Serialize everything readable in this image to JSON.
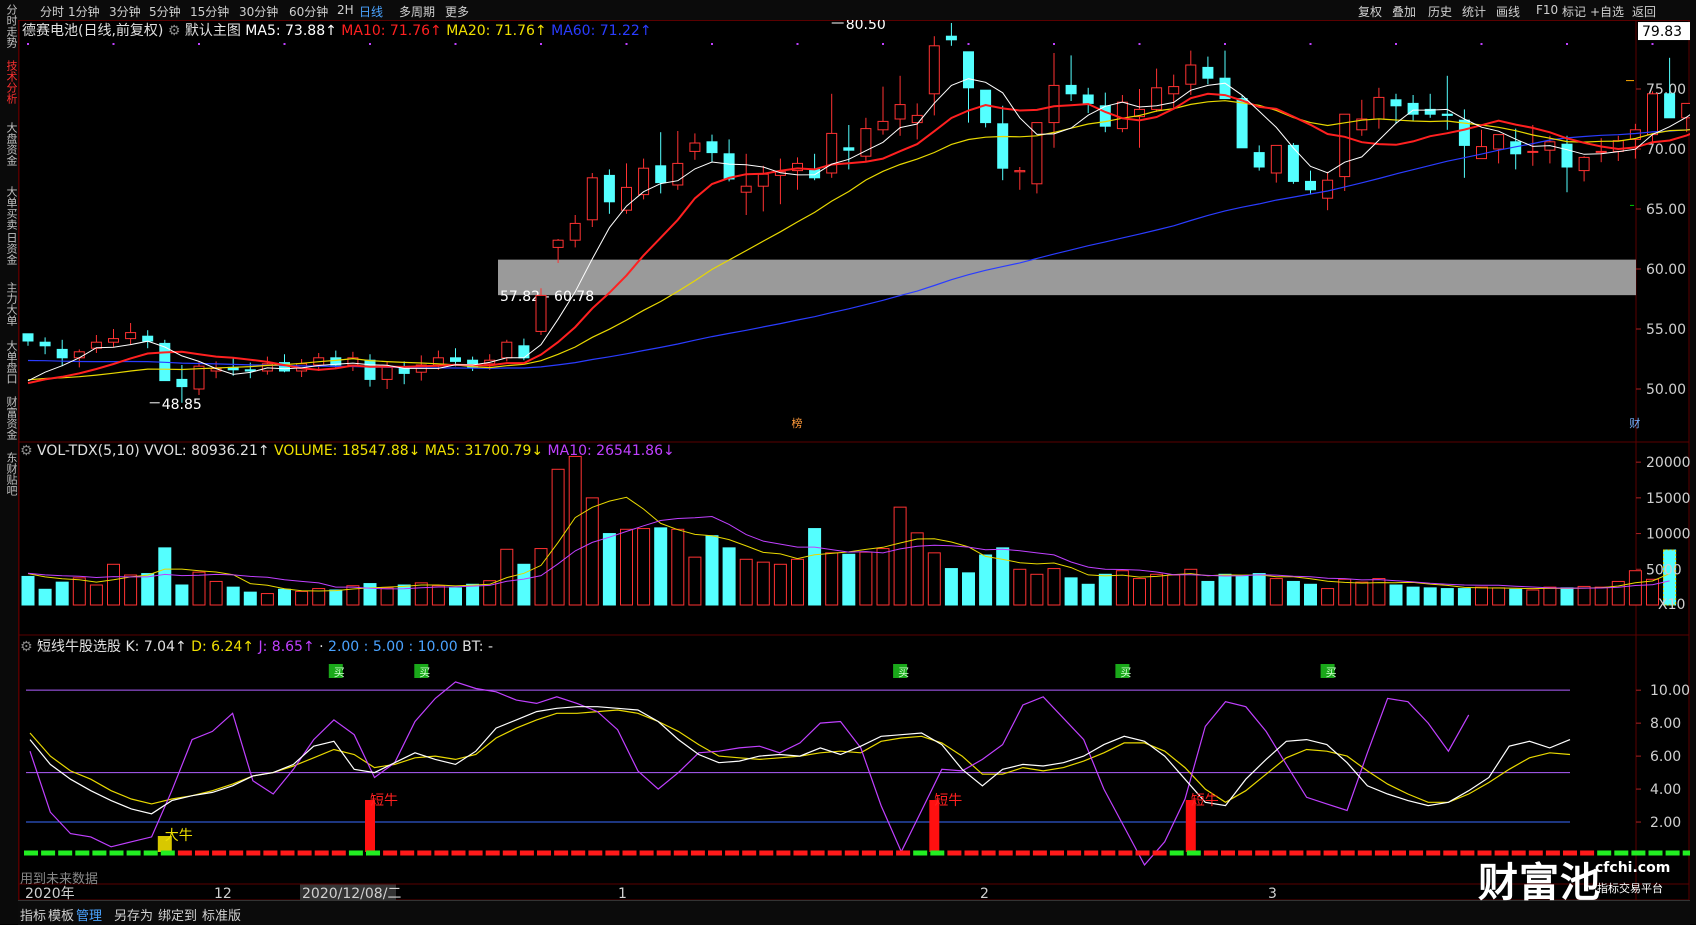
{
  "left_tabs": [
    "分时走势",
    "技术分析",
    "大盘资金",
    "大单买卖",
    "日资金",
    "主力大单",
    "大单盘口",
    "财富资金",
    "东财贴吧"
  ],
  "left_tab_active": 1,
  "toolbar": {
    "periods": [
      "分时",
      "1分钟",
      "3分钟",
      "5分钟",
      "15分钟",
      "30分钟",
      "60分钟",
      "2H",
      "日线",
      "多周期",
      "更多"
    ],
    "active_period": "日线",
    "right_tools": [
      "复权",
      "叠加",
      "历史",
      "统计",
      "画线",
      "F10",
      "标记",
      "+自选",
      "返回"
    ]
  },
  "price_panel": {
    "stock": "德赛电池(日线,前复权)",
    "template": "默认主图",
    "ma5": "MA5: 73.88↑",
    "ma10": "MA10: 71.76↑",
    "ma20": "MA20: 71.76↑",
    "ma60": "MA60: 71.22↑",
    "current_price": "79.83",
    "high_label": "80.50",
    "low_label": "48.85",
    "zone_label": "57.82 - 60.78",
    "zone_low": 57.82,
    "zone_high": 60.78,
    "marker_bang": "榜",
    "marker_cai": "财",
    "y_ticks": [
      "75.00",
      "70.00",
      "65.00",
      "60.00",
      "55.00",
      "50.00"
    ]
  },
  "volume_panel": {
    "title": "VOL-TDX(5,10) VVOL: 80936.21↑",
    "volume": "VOLUME: 18547.88↓",
    "ma5": "MA5: 31700.79↓",
    "ma10": "MA10: 26541.86↓",
    "y_ticks": [
      "20000",
      "15000",
      "10000",
      "5000"
    ],
    "unit": "X10"
  },
  "indicator_panel": {
    "title": "短线牛股选股",
    "k": "K: 7.04↑",
    "d": "D: 6.24↑",
    "j": "J: 8.65↑",
    "params": "2.00 : 5.00 : 10.00",
    "bt": "BT: -",
    "y_ticks": [
      "10.00",
      "8.00",
      "6.00",
      "4.00",
      "2.00"
    ],
    "buy_label": "买",
    "signal_big": "大牛",
    "signal_short": "短牛",
    "note": "用到未来数据"
  },
  "x_axis": {
    "labels": [
      "2020年",
      "12",
      "2020/12/08/二",
      "1",
      "2",
      "3"
    ]
  },
  "bottom_tabs": [
    "指标",
    "模板",
    "管理",
    "另存为",
    "绑定到",
    "标准版"
  ],
  "bottom_active": "管理",
  "logo": {
    "main": "财富池",
    "domain": "cfchi.com",
    "sub": "指标交易平台"
  },
  "colors": {
    "up": "#ff3232",
    "down": "#54ffff",
    "ma5": "#ffffff",
    "ma10": "#ff2020",
    "ma20": "#e8d800",
    "ma60": "#2a3cff",
    "j": "#c040ff"
  },
  "chart_data": {
    "type": "candlestick",
    "title": "德赛电池(日线,前复权)",
    "ylim": [
      47,
      81
    ],
    "candles": [
      [
        54.6,
        54.6,
        53.6,
        54.0
      ],
      [
        53.9,
        54.3,
        52.9,
        53.6
      ],
      [
        53.3,
        54.1,
        51.9,
        52.6
      ],
      [
        52.6,
        53.3,
        51.8,
        53.1
      ],
      [
        53.4,
        54.5,
        53.0,
        53.9
      ],
      [
        53.9,
        55.0,
        53.5,
        54.2
      ],
      [
        54.2,
        55.5,
        53.7,
        54.7
      ],
      [
        54.4,
        54.9,
        53.4,
        54.0
      ],
      [
        53.8,
        54.1,
        50.8,
        50.7
      ],
      [
        50.8,
        52.0,
        48.85,
        50.2
      ],
      [
        50.0,
        52.3,
        49.5,
        51.9
      ],
      [
        51.5,
        52.3,
        50.9,
        51.7
      ],
      [
        51.8,
        52.6,
        51.1,
        51.6
      ],
      [
        51.6,
        52.2,
        50.9,
        51.5
      ],
      [
        51.5,
        52.7,
        51.2,
        52.1
      ],
      [
        52.2,
        52.9,
        51.4,
        51.5
      ],
      [
        51.5,
        52.5,
        51.0,
        52.1
      ],
      [
        52.0,
        53.0,
        51.5,
        52.6
      ],
      [
        52.6,
        53.2,
        51.8,
        52.0
      ],
      [
        52.0,
        53.1,
        51.5,
        52.6
      ],
      [
        52.4,
        52.9,
        50.2,
        50.8
      ],
      [
        50.8,
        52.3,
        50.0,
        51.9
      ],
      [
        51.8,
        52.3,
        50.4,
        51.3
      ],
      [
        51.4,
        52.8,
        50.7,
        52.0
      ],
      [
        52.0,
        53.2,
        51.6,
        52.6
      ],
      [
        52.6,
        53.4,
        51.9,
        52.3
      ],
      [
        52.4,
        52.7,
        51.5,
        51.8
      ],
      [
        52.1,
        52.9,
        51.6,
        52.4
      ],
      [
        52.6,
        54.1,
        52.3,
        53.9
      ],
      [
        53.6,
        54.2,
        52.4,
        52.6
      ],
      [
        54.8,
        58.4,
        54.5,
        57.8
      ],
      [
        61.8,
        62.5,
        60.5,
        62.4
      ],
      [
        62.4,
        64.5,
        61.8,
        63.8
      ],
      [
        64.1,
        68.0,
        63.5,
        67.6
      ],
      [
        67.8,
        68.3,
        64.6,
        65.6
      ],
      [
        64.9,
        68.8,
        64.6,
        66.8
      ],
      [
        66.2,
        69.2,
        65.8,
        68.4
      ],
      [
        68.6,
        71.4,
        66.3,
        67.2
      ],
      [
        67.0,
        71.5,
        66.6,
        68.8
      ],
      [
        69.8,
        71.3,
        69.1,
        70.5
      ],
      [
        70.6,
        71.2,
        68.9,
        69.7
      ],
      [
        69.6,
        70.8,
        67.3,
        67.5
      ],
      [
        66.4,
        69.6,
        64.5,
        66.9
      ],
      [
        66.9,
        68.6,
        64.8,
        67.9
      ],
      [
        67.8,
        69.2,
        65.4,
        68.1
      ],
      [
        68.2,
        69.3,
        66.6,
        68.8
      ],
      [
        68.3,
        69.6,
        67.4,
        67.6
      ],
      [
        68.0,
        74.6,
        67.6,
        71.3
      ],
      [
        70.1,
        72.0,
        68.3,
        69.9
      ],
      [
        69.4,
        72.6,
        68.9,
        71.7
      ],
      [
        71.6,
        75.2,
        71.2,
        72.3
      ],
      [
        72.5,
        76.1,
        71.1,
        73.7
      ],
      [
        72.2,
        73.8,
        70.8,
        72.8
      ],
      [
        74.6,
        79.4,
        72.8,
        78.6
      ],
      [
        79.4,
        80.5,
        78.6,
        79.1
      ],
      [
        78.1,
        76.6,
        72.2,
        75.1
      ],
      [
        74.9,
        74.8,
        71.8,
        72.2
      ],
      [
        72.1,
        73.6,
        67.4,
        68.4
      ],
      [
        68.1,
        68.5,
        66.6,
        68.2
      ],
      [
        67.1,
        72.0,
        66.3,
        72.2
      ],
      [
        72.2,
        78.0,
        70.1,
        75.3
      ],
      [
        75.3,
        77.8,
        74.0,
        74.6
      ],
      [
        74.5,
        75.1,
        73.0,
        73.8
      ],
      [
        73.6,
        74.7,
        71.4,
        71.9
      ],
      [
        71.7,
        74.5,
        71.4,
        73.9
      ],
      [
        72.7,
        75.0,
        70.1,
        73.3
      ],
      [
        73.3,
        76.7,
        73.1,
        75.1
      ],
      [
        74.6,
        76.2,
        73.3,
        75.2
      ],
      [
        75.4,
        78.2,
        74.5,
        77.0
      ],
      [
        76.8,
        77.7,
        75.4,
        75.9
      ],
      [
        75.9,
        78.2,
        74.8,
        74.2
      ],
      [
        74.2,
        74.5,
        70.1,
        70.1
      ],
      [
        69.7,
        70.3,
        68.2,
        68.5
      ],
      [
        68.0,
        70.0,
        67.2,
        70.3
      ],
      [
        70.3,
        70.5,
        67.1,
        67.3
      ],
      [
        67.3,
        68.2,
        66.2,
        66.6
      ],
      [
        65.9,
        68.1,
        64.9,
        67.4
      ],
      [
        67.7,
        72.6,
        66.5,
        72.9
      ],
      [
        71.6,
        74.1,
        71.1,
        72.5
      ],
      [
        72.5,
        75.1,
        71.7,
        74.3
      ],
      [
        74.1,
        74.6,
        72.1,
        73.6
      ],
      [
        73.8,
        74.5,
        72.3,
        72.9
      ],
      [
        73.3,
        74.6,
        72.6,
        72.9
      ],
      [
        72.9,
        76.1,
        71.6,
        72.8
      ],
      [
        72.4,
        73.3,
        67.6,
        70.3
      ],
      [
        69.2,
        71.6,
        69.3,
        70.2
      ],
      [
        70.0,
        71.2,
        68.8,
        71.2
      ],
      [
        70.6,
        71.7,
        68.3,
        69.6
      ],
      [
        69.8,
        72.0,
        68.6,
        69.8
      ],
      [
        69.9,
        71.1,
        68.8,
        70.6
      ],
      [
        70.4,
        71.1,
        66.4,
        68.5
      ],
      [
        68.2,
        69.4,
        67.3,
        69.3
      ],
      [
        69.8,
        70.9,
        68.9,
        69.8
      ],
      [
        69.8,
        71.1,
        69.0,
        70.7
      ],
      [
        70.8,
        72.1,
        69.2,
        71.6
      ],
      [
        71.2,
        74.8,
        70.4,
        74.6
      ],
      [
        74.6,
        77.6,
        74.4,
        72.6
      ],
      [
        72.6,
        73.8,
        71.4,
        73.8
      ],
      [
        72.5,
        75.9,
        71.0,
        75.7
      ]
    ],
    "volume": [
      4000,
      2200,
      3200,
      3800,
      2800,
      5700,
      4200,
      4400,
      8000,
      2800,
      4600,
      3300,
      2500,
      1800,
      1600,
      2200,
      1900,
      2300,
      2100,
      2700,
      3000,
      2400,
      2800,
      3100,
      2700,
      2400,
      2900,
      3400,
      7800,
      5700,
      7900,
      19000,
      20800,
      15000,
      10000,
      10600,
      10700,
      10800,
      10600,
      6700,
      9700,
      8000,
      6400,
      6000,
      5700,
      6400,
      10700,
      7300,
      7100,
      7400,
      7900,
      13700,
      10100,
      7300,
      5100,
      4500,
      7000,
      8000,
      5000,
      4300,
      5100,
      3800,
      2900,
      4300,
      4800,
      3700,
      4300,
      4200,
      5000,
      3300,
      4300,
      4100,
      4400,
      3700,
      3300,
      2900,
      2300,
      3600,
      3200,
      3700,
      2800,
      2500,
      2400,
      2300,
      2300,
      2500,
      2400,
      2200,
      2100,
      2500,
      2400,
      2600,
      2500,
      3300,
      4800,
      3600,
      7700
    ],
    "kdj": {
      "k": [
        7.0,
        5.5,
        4.6,
        3.9,
        3.3,
        2.8,
        2.5,
        3.3,
        3.6,
        3.8,
        4.2,
        4.8,
        5.0,
        5.5,
        6.6,
        6.9,
        5.2,
        5.0,
        5.6,
        6.2,
        5.8,
        5.5,
        6.3,
        7.7,
        8.2,
        8.7,
        8.9,
        9.0,
        9.0,
        8.9,
        8.8,
        8.1,
        7.0,
        6.1,
        5.6,
        5.7,
        6.0,
        6.1,
        6.0,
        6.5,
        6.1,
        6.6,
        7.2,
        7.3,
        7.4,
        6.7,
        5.2,
        4.2,
        5.2,
        5.5,
        5.4,
        5.6,
        6.0,
        6.7,
        7.2,
        6.9,
        6.0,
        4.6,
        3.2,
        3.0,
        4.6,
        5.8,
        6.9,
        7.0,
        6.7,
        5.6,
        4.2,
        3.7,
        3.3,
        3.0,
        3.2,
        3.9,
        4.7,
        6.6,
        6.9,
        6.5,
        7.0
      ],
      "d": [
        7.4,
        6.0,
        5.1,
        4.6,
        3.9,
        3.4,
        3.1,
        3.4,
        3.6,
        3.9,
        4.3,
        4.8,
        5.0,
        5.4,
        5.9,
        6.4,
        6.1,
        5.3,
        5.5,
        5.9,
        6.0,
        5.8,
        6.1,
        7.1,
        7.7,
        8.2,
        8.6,
        8.6,
        8.7,
        8.8,
        8.6,
        8.1,
        7.5,
        6.7,
        6.0,
        5.9,
        5.8,
        5.9,
        6.0,
        6.2,
        6.3,
        6.2,
        6.9,
        7.1,
        7.2,
        6.8,
        6.0,
        4.9,
        4.9,
        5.3,
        5.1,
        5.3,
        5.7,
        6.2,
        6.8,
        6.8,
        6.3,
        5.3,
        4.0,
        3.2,
        3.9,
        4.9,
        5.9,
        6.4,
        6.3,
        6.0,
        5.1,
        4.3,
        3.7,
        3.2,
        3.2,
        3.7,
        4.4,
        5.2,
        5.9,
        6.2,
        6.1
      ],
      "j": [
        6.3,
        2.6,
        1.3,
        1.1,
        0.5,
        0.8,
        1.1,
        3.9,
        7.0,
        7.5,
        8.6,
        4.5,
        3.7,
        5.2,
        7.0,
        8.2,
        7.3,
        4.7,
        5.6,
        8.1,
        9.5,
        10.5,
        10.1,
        9.9,
        9.4,
        9.2,
        9.6,
        9.2,
        8.7,
        7.6,
        5.1,
        4.0,
        5.0,
        6.2,
        6.3,
        6.5,
        6.6,
        6.2,
        6.8,
        8.0,
        8.1,
        6.5,
        3.0,
        0.2,
        2.7,
        5.2,
        5.1,
        5.8,
        6.7,
        9.1,
        9.6,
        8.3,
        7.0,
        4.0,
        1.7,
        -0.6,
        0.8,
        3.4,
        7.8,
        9.3,
        9.0,
        7.5,
        5.5,
        3.5,
        3.1,
        2.7,
        6.2,
        9.5,
        9.3,
        8.0,
        6.3,
        8.5
      ]
    }
  }
}
